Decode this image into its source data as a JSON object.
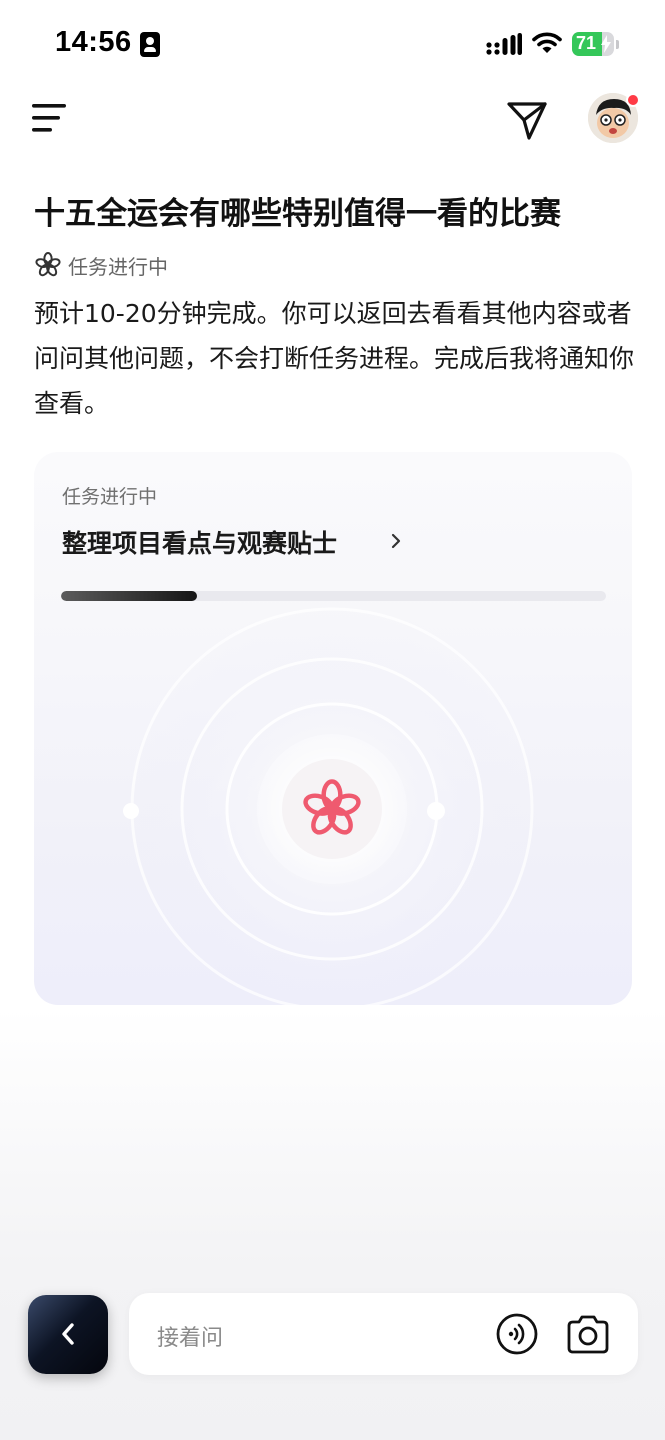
{
  "status_bar": {
    "time": "14:56",
    "battery_percent": "71",
    "battery_level": 0.71
  },
  "header": {
    "menu_icon": "menu-lines-icon",
    "send_icon": "paper-plane-icon",
    "avatar_icon": "cartoon-avatar",
    "notification_dot_color": "#ff3b46"
  },
  "main": {
    "title": "十五全运会有哪些特别值得一看的比赛",
    "status_label": "任务进行中",
    "description": "预计10-20分钟完成。你可以返回去看看其他内容或者问问其他问题，不会打断任务进程。完成后我将通知你查看。"
  },
  "task_card": {
    "label": "任务进行中",
    "current_step": "整理项目看点与观赛贴士",
    "progress": 0.25,
    "accent_color": "#ef5a6f"
  },
  "bottom_bar": {
    "input_placeholder": "接着问",
    "back_icon": "chevron-left-icon",
    "voice_icon": "voice-wave-icon",
    "camera_icon": "camera-icon"
  }
}
